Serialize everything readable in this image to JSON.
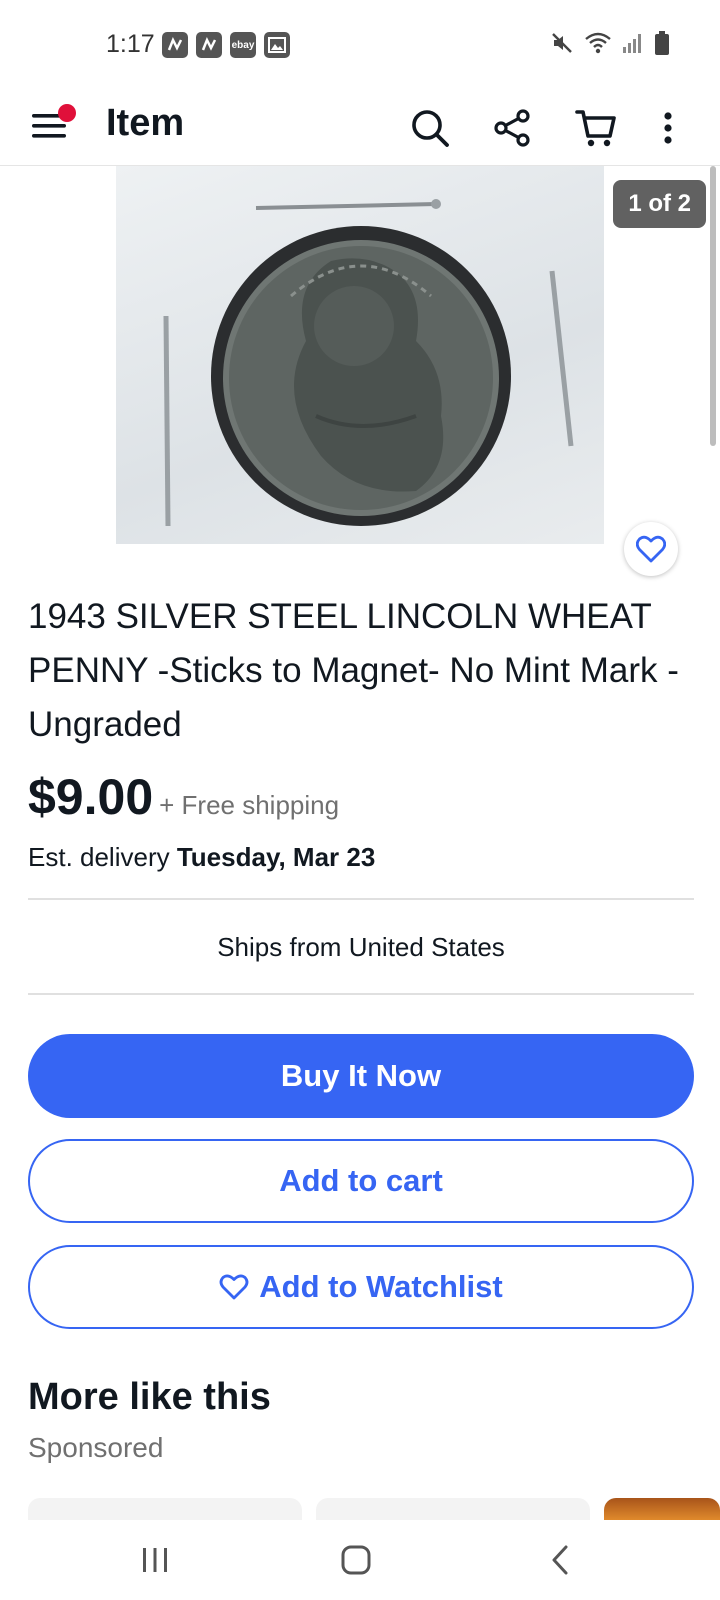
{
  "status": {
    "time": "1:17",
    "ebay_badge": "ebay"
  },
  "header": {
    "title": "Item"
  },
  "gallery": {
    "counter": "1 of 2"
  },
  "item": {
    "title": "1943 SILVER STEEL LINCOLN WHEAT PENNY -Sticks to Magnet- No Mint Mark - Ungraded",
    "price": "$9.00",
    "shipping": "+ Free shipping",
    "delivery_prefix": "Est. delivery",
    "delivery_date": "Tuesday, Mar 23",
    "ships_from": "Ships from United States"
  },
  "actions": {
    "buy_now": "Buy It Now",
    "add_to_cart": "Add to cart",
    "add_to_watchlist": "Add to Watchlist"
  },
  "more": {
    "title": "More like this",
    "subtitle": "Sponsored"
  },
  "colors": {
    "accent": "#3665f3",
    "notification": "#e0103a",
    "text": "#111820",
    "muted": "#707070"
  }
}
